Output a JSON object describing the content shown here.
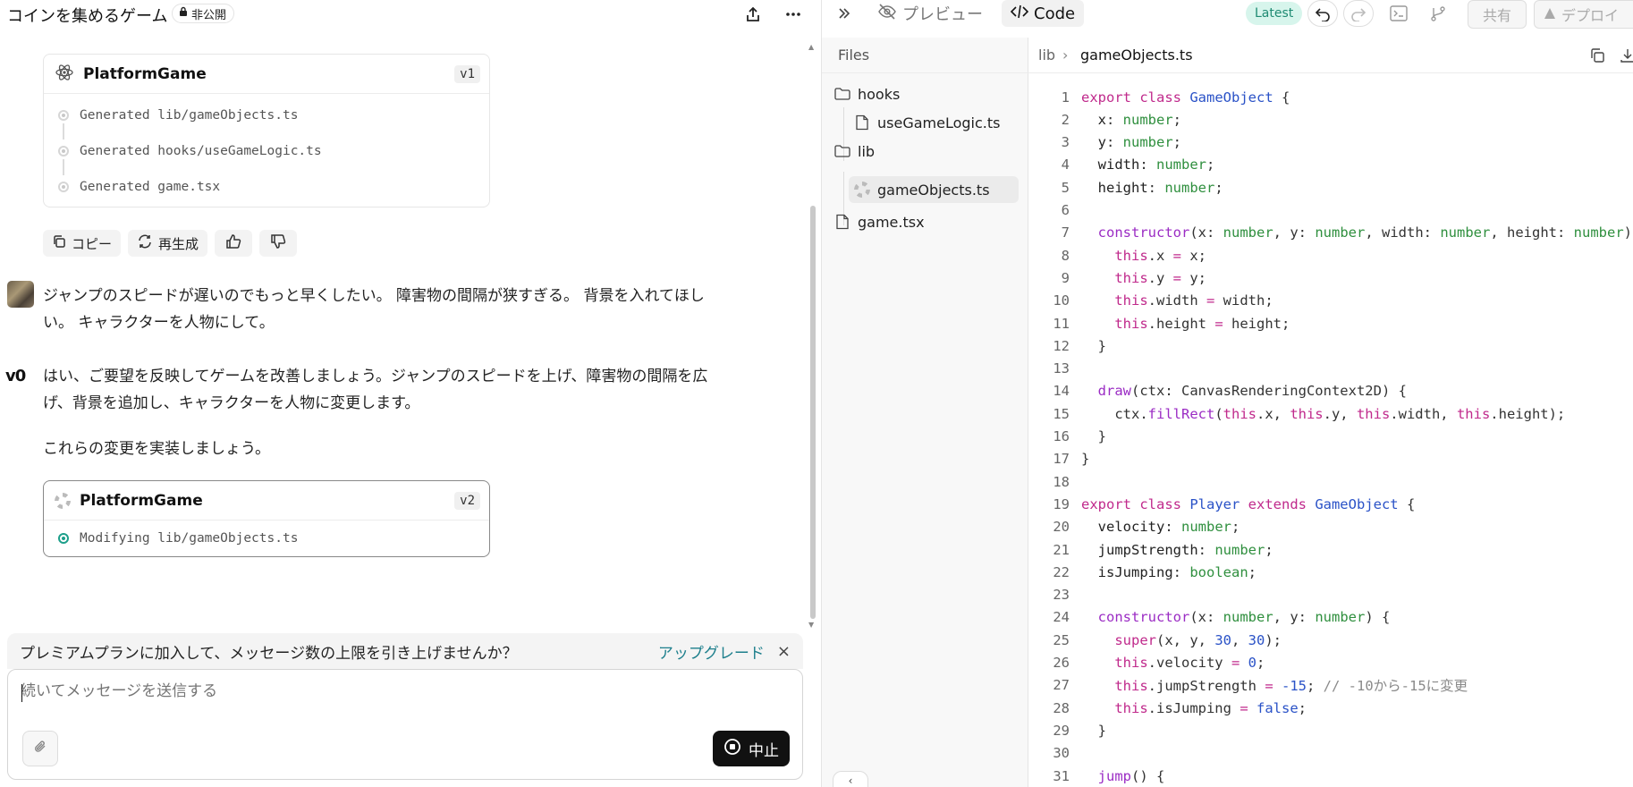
{
  "chat": {
    "title": "コインを集めるゲーム",
    "visibility": "非公開",
    "card1": {
      "title": "PlatformGame",
      "version": "v1",
      "steps": [
        "Generated lib/gameObjects.ts",
        "Generated hooks/useGameLogic.ts",
        "Generated game.tsx"
      ]
    },
    "actions": {
      "copy": "コピー",
      "regenerate": "再生成"
    },
    "user_message": "ジャンプのスピードが遅いのでもっと早くしたい。 障害物の間隔が狭すぎる。 背景を入れてほしい。 キャラクターを人物にして。",
    "assistant_logo": "v0",
    "assistant_message_1": "はい、ご要望を反映してゲームを改善しましょう。ジャンプのスピードを上げ、障害物の間隔を広げ、背景を追加し、キャラクターを人物に変更します。",
    "assistant_message_2": "これらの変更を実装しましょう。",
    "card2": {
      "title": "PlatformGame",
      "version": "v2",
      "step": "Modifying lib/gameObjects.ts"
    },
    "upsell": {
      "text": "プレミアムプランに加入して、メッセージ数の上限を引き上げませんか？",
      "link": "アップグレード",
      "close": "×"
    },
    "composer": {
      "placeholder": "続いてメッセージを送信する",
      "stop": "中止"
    }
  },
  "workspace": {
    "tabs": {
      "preview": "プレビュー",
      "code": "Code"
    },
    "latest_badge": "Latest",
    "share": "共有",
    "deploy": "デプロイ",
    "files_label": "Files",
    "tree": {
      "hooks": "hooks",
      "useGameLogic": "useGameLogic.ts",
      "lib": "lib",
      "gameObjects": "gameObjects.ts",
      "game": "game.tsx"
    },
    "breadcrumb": {
      "folder": "lib",
      "file": "gameObjects.ts"
    }
  },
  "code_lines": [
    [
      1,
      [
        [
          "kw",
          "export "
        ],
        [
          "kw",
          "class "
        ],
        [
          "cls",
          "GameObject"
        ],
        [
          "punc",
          " {"
        ]
      ]
    ],
    [
      2,
      [
        [
          "prop",
          "  x"
        ],
        [
          "punc",
          ": "
        ],
        [
          "ty",
          "number"
        ],
        [
          "punc",
          ";"
        ]
      ]
    ],
    [
      3,
      [
        [
          "prop",
          "  y"
        ],
        [
          "punc",
          ": "
        ],
        [
          "ty",
          "number"
        ],
        [
          "punc",
          ";"
        ]
      ]
    ],
    [
      4,
      [
        [
          "prop",
          "  width"
        ],
        [
          "punc",
          ": "
        ],
        [
          "ty",
          "number"
        ],
        [
          "punc",
          ";"
        ]
      ]
    ],
    [
      5,
      [
        [
          "prop",
          "  height"
        ],
        [
          "punc",
          ": "
        ],
        [
          "ty",
          "number"
        ],
        [
          "punc",
          ";"
        ]
      ]
    ],
    [
      6,
      []
    ],
    [
      7,
      [
        [
          "fn",
          "  constructor"
        ],
        [
          "punc",
          "(x: "
        ],
        [
          "ty",
          "number"
        ],
        [
          "punc",
          ", y: "
        ],
        [
          "ty",
          "number"
        ],
        [
          "punc",
          ", width: "
        ],
        [
          "ty",
          "number"
        ],
        [
          "punc",
          ", height: "
        ],
        [
          "ty",
          "number"
        ],
        [
          "punc",
          ") {"
        ]
      ]
    ],
    [
      8,
      [
        [
          "kw",
          "    this"
        ],
        [
          "punc",
          ".x "
        ],
        [
          "kw",
          "="
        ],
        [
          "punc",
          " x;"
        ]
      ]
    ],
    [
      9,
      [
        [
          "kw",
          "    this"
        ],
        [
          "punc",
          ".y "
        ],
        [
          "kw",
          "="
        ],
        [
          "punc",
          " y;"
        ]
      ]
    ],
    [
      10,
      [
        [
          "kw",
          "    this"
        ],
        [
          "punc",
          ".width "
        ],
        [
          "kw",
          "="
        ],
        [
          "punc",
          " width;"
        ]
      ]
    ],
    [
      11,
      [
        [
          "kw",
          "    this"
        ],
        [
          "punc",
          ".height "
        ],
        [
          "kw",
          "="
        ],
        [
          "punc",
          " height;"
        ]
      ]
    ],
    [
      12,
      [
        [
          "punc",
          "  }"
        ]
      ]
    ],
    [
      13,
      []
    ],
    [
      14,
      [
        [
          "fn",
          "  draw"
        ],
        [
          "punc",
          "(ctx: CanvasRenderingContext2D) {"
        ]
      ]
    ],
    [
      15,
      [
        [
          "punc",
          "    ctx."
        ],
        [
          "fn",
          "fillRect"
        ],
        [
          "punc",
          "("
        ],
        [
          "kw",
          "this"
        ],
        [
          "punc",
          ".x, "
        ],
        [
          "kw",
          "this"
        ],
        [
          "punc",
          ".y, "
        ],
        [
          "kw",
          "this"
        ],
        [
          "punc",
          ".width, "
        ],
        [
          "kw",
          "this"
        ],
        [
          "punc",
          ".height);"
        ]
      ]
    ],
    [
      16,
      [
        [
          "punc",
          "  }"
        ]
      ]
    ],
    [
      17,
      [
        [
          "punc",
          "}"
        ]
      ]
    ],
    [
      18,
      []
    ],
    [
      19,
      [
        [
          "kw",
          "export "
        ],
        [
          "kw",
          "class "
        ],
        [
          "cls",
          "Player "
        ],
        [
          "kw",
          "extends "
        ],
        [
          "cls",
          "GameObject"
        ],
        [
          "punc",
          " {"
        ]
      ]
    ],
    [
      20,
      [
        [
          "prop",
          "  velocity"
        ],
        [
          "punc",
          ": "
        ],
        [
          "ty",
          "number"
        ],
        [
          "punc",
          ";"
        ]
      ]
    ],
    [
      21,
      [
        [
          "prop",
          "  jumpStrength"
        ],
        [
          "punc",
          ": "
        ],
        [
          "ty",
          "number"
        ],
        [
          "punc",
          ";"
        ]
      ]
    ],
    [
      22,
      [
        [
          "prop",
          "  isJumping"
        ],
        [
          "punc",
          ": "
        ],
        [
          "ty",
          "boolean"
        ],
        [
          "punc",
          ";"
        ]
      ]
    ],
    [
      23,
      []
    ],
    [
      24,
      [
        [
          "fn",
          "  constructor"
        ],
        [
          "punc",
          "(x: "
        ],
        [
          "ty",
          "number"
        ],
        [
          "punc",
          ", y: "
        ],
        [
          "ty",
          "number"
        ],
        [
          "punc",
          ") {"
        ]
      ]
    ],
    [
      25,
      [
        [
          "kw",
          "    super"
        ],
        [
          "punc",
          "(x, y, "
        ],
        [
          "num",
          "30"
        ],
        [
          "punc",
          ", "
        ],
        [
          "num",
          "30"
        ],
        [
          "punc",
          ");"
        ]
      ]
    ],
    [
      26,
      [
        [
          "kw",
          "    this"
        ],
        [
          "punc",
          ".velocity "
        ],
        [
          "kw",
          "="
        ],
        [
          "punc",
          " "
        ],
        [
          "num",
          "0"
        ],
        [
          "punc",
          ";"
        ]
      ]
    ],
    [
      27,
      [
        [
          "kw",
          "    this"
        ],
        [
          "punc",
          ".jumpStrength "
        ],
        [
          "kw",
          "="
        ],
        [
          "punc",
          " "
        ],
        [
          "num",
          "-15"
        ],
        [
          "punc",
          "; "
        ],
        [
          "cm",
          "// -10から-15に変更"
        ]
      ]
    ],
    [
      28,
      [
        [
          "kw",
          "    this"
        ],
        [
          "punc",
          ".isJumping "
        ],
        [
          "kw",
          "="
        ],
        [
          "punc",
          " "
        ],
        [
          "num",
          "false"
        ],
        [
          "punc",
          ";"
        ]
      ]
    ],
    [
      29,
      [
        [
          "punc",
          "  }"
        ]
      ]
    ],
    [
      30,
      []
    ],
    [
      31,
      [
        [
          "fn",
          "  jump"
        ],
        [
          "punc",
          "() {"
        ]
      ]
    ]
  ]
}
